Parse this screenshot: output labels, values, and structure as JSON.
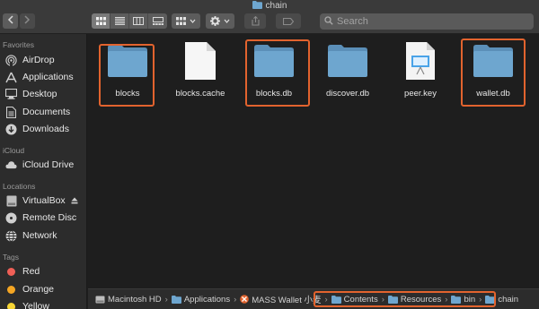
{
  "window": {
    "title": "chain"
  },
  "search": {
    "placeholder": "Search"
  },
  "sidebar": {
    "favorites_label": "Favorites",
    "favorites": [
      "AirDrop",
      "Applications",
      "Desktop",
      "Documents",
      "Downloads"
    ],
    "icloud_label": "iCloud",
    "icloud": [
      "iCloud Drive"
    ],
    "locations_label": "Locations",
    "locations": [
      "VirtualBox",
      "Remote Disc",
      "Network"
    ],
    "tags_label": "Tags",
    "tags": [
      {
        "label": "Red",
        "color": "#ef5f56"
      },
      {
        "label": "Orange",
        "color": "#f5a623"
      },
      {
        "label": "Yellow",
        "color": "#f6d535"
      }
    ]
  },
  "files": [
    {
      "name": "blocks",
      "kind": "folder",
      "highlighted": true
    },
    {
      "name": "blocks.cache",
      "kind": "document",
      "highlighted": false
    },
    {
      "name": "blocks.db",
      "kind": "folder",
      "highlighted": true
    },
    {
      "name": "discover.db",
      "kind": "folder",
      "highlighted": false
    },
    {
      "name": "peer.key",
      "kind": "keynote",
      "highlighted": false
    },
    {
      "name": "wallet.db",
      "kind": "folder",
      "highlighted": true
    }
  ],
  "pathbar": {
    "crumbs": [
      "Macintosh HD",
      "Applications",
      "MASS Wallet 小麦",
      "Contents",
      "Resources",
      "bin",
      "chain"
    ]
  },
  "colors": {
    "highlight": "#e2632e",
    "folder": "#6ea6cf",
    "folder_tab": "#5b8fb8"
  }
}
